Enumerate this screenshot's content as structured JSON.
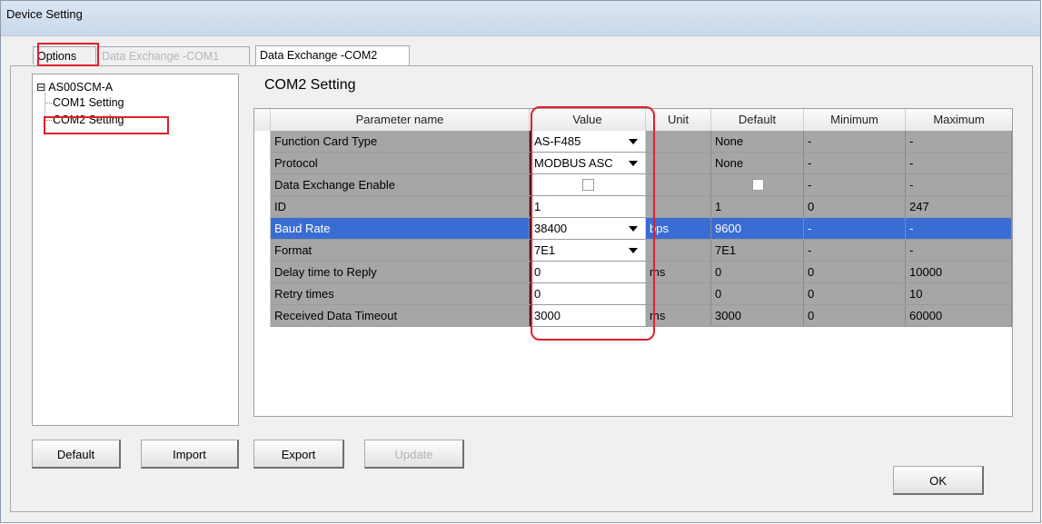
{
  "window": {
    "title": "Device Setting"
  },
  "tabs": [
    {
      "label": "Options",
      "state": "normal"
    },
    {
      "label": "Data Exchange -COM1",
      "state": "disabled"
    },
    {
      "label": "Data Exchange -COM2",
      "state": "active"
    }
  ],
  "tree": {
    "root": "AS00SCM-A",
    "expander": "⊟",
    "children": [
      "COM1 Setting",
      "COM2 Setting"
    ],
    "selected": "COM2 Setting"
  },
  "section_title": "COM2 Setting",
  "grid": {
    "headers": {
      "parameter": "Parameter name",
      "value": "Value",
      "unit": "Unit",
      "default": "Default",
      "minimum": "Minimum",
      "maximum": "Maximum"
    },
    "rows": [
      {
        "name": "Function Card Type",
        "value": "AS-F485",
        "dropdown": true,
        "checkbox": false,
        "unit": "",
        "default": "None",
        "default_checkbox": false,
        "minimum": "-",
        "maximum": "-"
      },
      {
        "name": "Protocol",
        "value": "MODBUS ASC",
        "dropdown": true,
        "checkbox": false,
        "unit": "",
        "default": "None",
        "default_checkbox": false,
        "minimum": "-",
        "maximum": "-"
      },
      {
        "name": "Data Exchange Enable",
        "value": "",
        "dropdown": false,
        "checkbox": true,
        "checked": false,
        "unit": "",
        "default": "",
        "default_checkbox": true,
        "minimum": "-",
        "maximum": "-"
      },
      {
        "name": "ID",
        "value": "1",
        "dropdown": false,
        "checkbox": false,
        "unit": "",
        "default": "1",
        "default_checkbox": false,
        "minimum": "0",
        "maximum": "247"
      },
      {
        "name": "Baud Rate",
        "value": "38400",
        "dropdown": true,
        "checkbox": false,
        "unit": "bps",
        "default": "9600",
        "default_checkbox": false,
        "minimum": "-",
        "maximum": "-",
        "selected": true
      },
      {
        "name": "Format",
        "value": "7E1",
        "dropdown": true,
        "checkbox": false,
        "unit": "",
        "default": "7E1",
        "default_checkbox": false,
        "minimum": "-",
        "maximum": "-"
      },
      {
        "name": "Delay time to Reply",
        "value": "0",
        "dropdown": false,
        "checkbox": false,
        "unit": "ms",
        "default": "0",
        "default_checkbox": false,
        "minimum": "0",
        "maximum": "10000"
      },
      {
        "name": "Retry times",
        "value": "0",
        "dropdown": false,
        "checkbox": false,
        "unit": "",
        "default": "0",
        "default_checkbox": false,
        "minimum": "0",
        "maximum": "10"
      },
      {
        "name": "Received Data Timeout",
        "value": "3000",
        "dropdown": false,
        "checkbox": false,
        "unit": "ms",
        "default": "3000",
        "default_checkbox": false,
        "minimum": "0",
        "maximum": "60000"
      }
    ]
  },
  "buttons": {
    "default": "Default",
    "import": "Import",
    "export": "Export",
    "update": "Update",
    "ok": "OK"
  },
  "colors": {
    "highlight": "#e0202a",
    "selection": "#3a6dd4",
    "row_fill": "#a6a6a6"
  }
}
